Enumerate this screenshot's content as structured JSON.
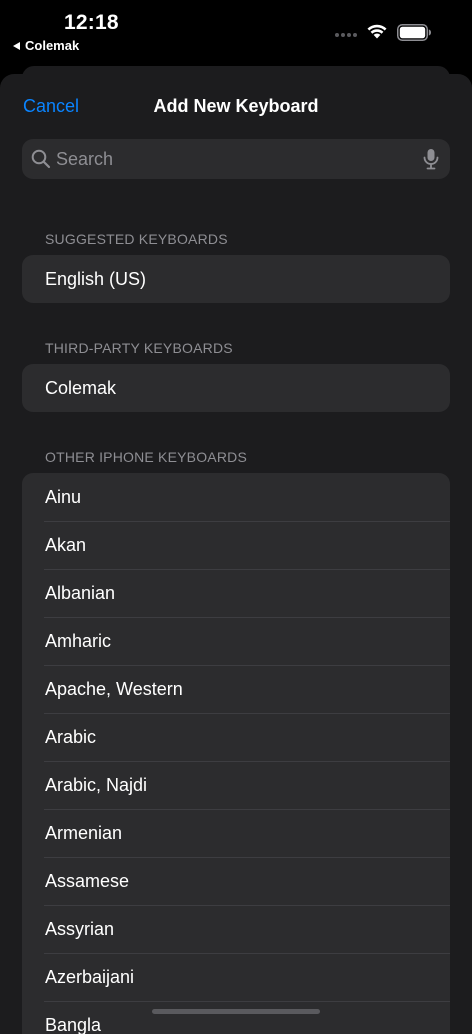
{
  "status_bar": {
    "time": "12:18",
    "back_app": "Colemak"
  },
  "nav": {
    "cancel_label": "Cancel",
    "title": "Add New Keyboard"
  },
  "search": {
    "placeholder": "Search",
    "value": ""
  },
  "sections": {
    "suggested": {
      "header": "SUGGESTED KEYBOARDS",
      "items": [
        "English (US)"
      ]
    },
    "third_party": {
      "header": "THIRD-PARTY KEYBOARDS",
      "items": [
        "Colemak"
      ]
    },
    "other": {
      "header": "OTHER IPHONE KEYBOARDS",
      "items": [
        "Ainu",
        "Akan",
        "Albanian",
        "Amharic",
        "Apache, Western",
        "Arabic",
        "Arabic, Najdi",
        "Armenian",
        "Assamese",
        "Assyrian",
        "Azerbaijani",
        "Bangla"
      ]
    }
  },
  "colors": {
    "accent": "#0a84ff",
    "background": "#000000",
    "sheet": "#1c1c1e",
    "cell": "#2c2c2e",
    "secondary_text": "#8e8e93"
  },
  "icons": {
    "search": "magnifier-icon",
    "mic": "microphone-icon",
    "wifi": "wifi-icon",
    "battery": "battery-icon",
    "back": "back-triangle-icon"
  }
}
